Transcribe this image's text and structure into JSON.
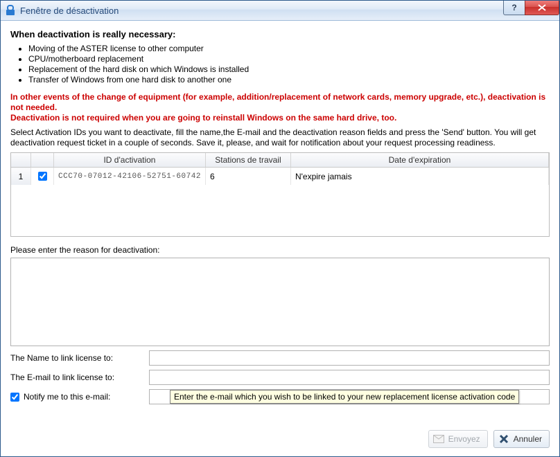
{
  "window": {
    "title": "Fenêtre de désactivation"
  },
  "heading": "When deactivation is really necessary:",
  "reasons": [
    "Moving of the ASTER license to other computer",
    "CPU/motherboard replacement",
    "Replacement of the hard disk on which Windows is installed",
    "Transfer of Windows from one hard disk to another one"
  ],
  "warning_line1": "In other events of the change of equipment (for example, addition/replacement of network cards, memory upgrade, etc.), deactivation is not needed.",
  "warning_line2": "Deactivation is not required when you are going to reinstall Windows on the same hard drive, too.",
  "instructions": "Select Activation IDs you want to deactivate, fill the name,the E-mail and the deactivation reason fields and press the 'Send' button. You will get deactivation request ticket in a couple of seconds. Save it, please, and wait for notification about your request processing readiness.",
  "table": {
    "headers": {
      "id": "ID d'activation",
      "stations": "Stations de travail",
      "expiry": "Date d'expiration"
    },
    "rows": [
      {
        "num": "1",
        "checked": true,
        "id": "CCC70-07012-42106-52751-60742",
        "stations": "6",
        "expiry": "N'expire jamais"
      }
    ]
  },
  "reason_label": "Please enter the reason for deactivation:",
  "reason_value": "",
  "form": {
    "name_label": "The Name to link license to:",
    "name_value": "",
    "email_label": "The E-mail to link license to:",
    "email_value": "",
    "notify_label": "Notify me to this e-mail:",
    "notify_checked": true,
    "notify_value": ""
  },
  "tooltip": "Enter the e-mail which you wish to be linked to your new replacement license activation code",
  "buttons": {
    "send": "Envoyez",
    "cancel": "Annuler"
  }
}
